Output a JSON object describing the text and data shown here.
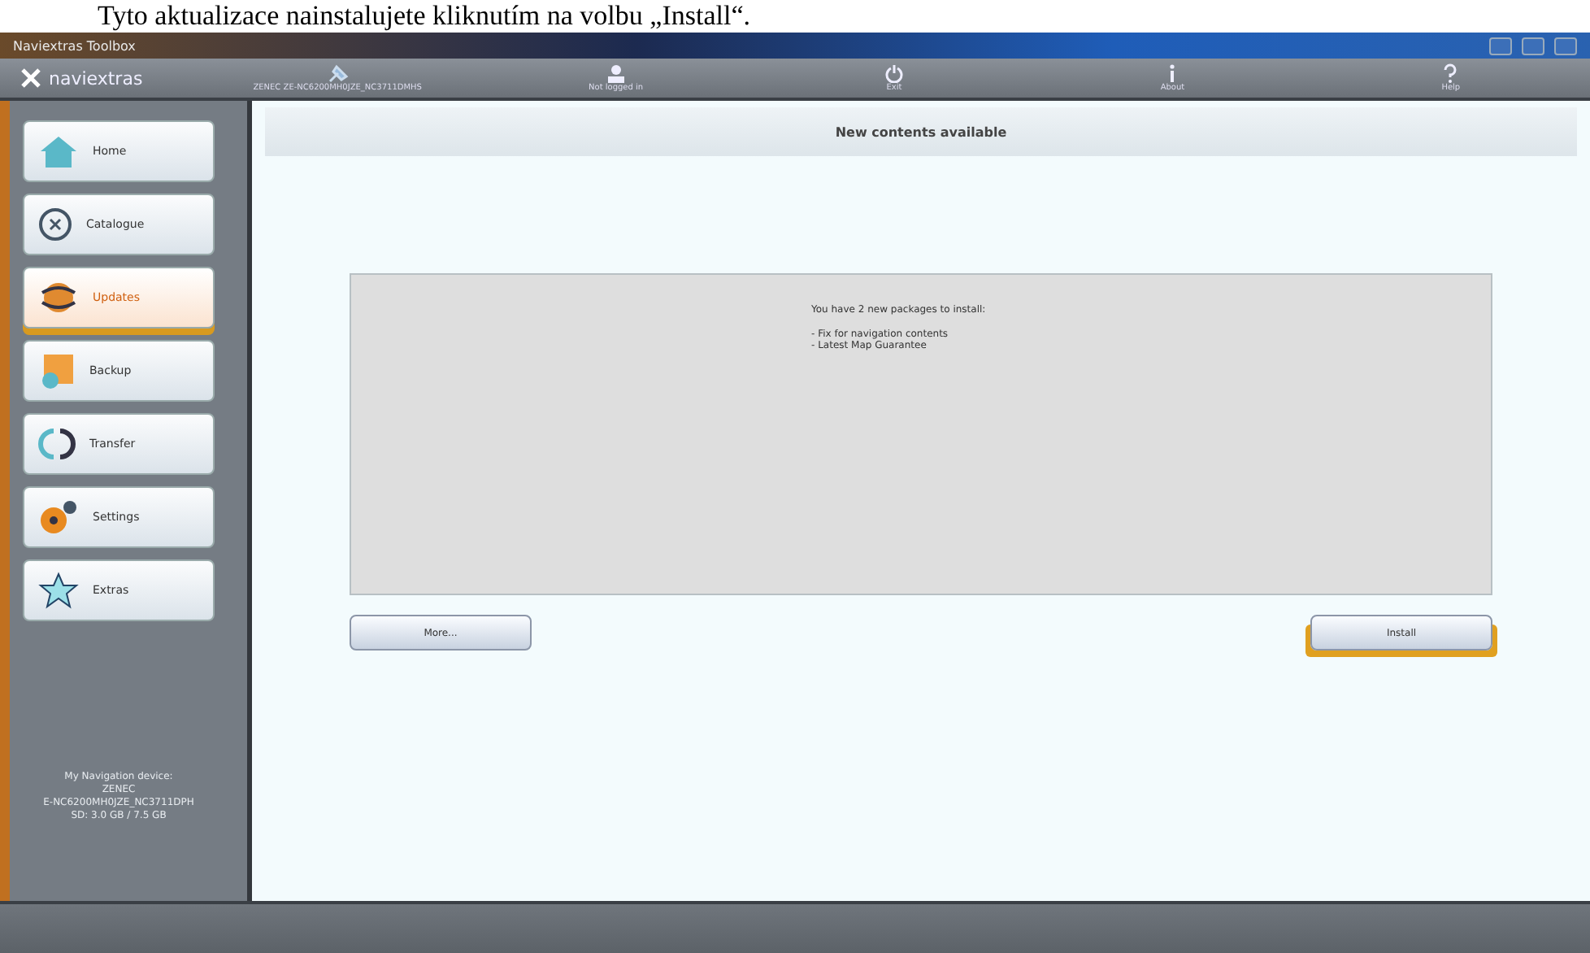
{
  "caption": "Tyto aktualizace nainstalujete kliknutím na volbu „Install“.",
  "window": {
    "title": "Naviextras Toolbox"
  },
  "toolbar": {
    "logo": "naviextras",
    "items": [
      {
        "kind": "device",
        "label": "ZENEC ZE-NC6200MH0JZE_NC3711DMHS"
      },
      {
        "kind": "user",
        "label": "Not logged in"
      },
      {
        "kind": "exit",
        "label": "Exit"
      },
      {
        "kind": "about",
        "label": "About"
      },
      {
        "kind": "help",
        "label": "Help"
      }
    ]
  },
  "sidebar": {
    "items": [
      {
        "kind": "home",
        "label": "Home",
        "selected": false
      },
      {
        "kind": "catalogue",
        "label": "Catalogue",
        "selected": false
      },
      {
        "kind": "updates",
        "label": "Updates",
        "selected": true
      },
      {
        "kind": "backup",
        "label": "Backup",
        "selected": false
      },
      {
        "kind": "transfer",
        "label": "Transfer",
        "selected": false
      },
      {
        "kind": "settings",
        "label": "Settings",
        "selected": false
      },
      {
        "kind": "extras",
        "label": "Extras",
        "selected": false
      }
    ],
    "device_info": [
      "My Navigation device:",
      "ZENEC",
      "E-NC6200MH0JZE_NC3711DPH",
      "SD: 3.0 GB / 7.5 GB"
    ]
  },
  "content": {
    "header": "New contents available",
    "message": "You have 2 new packages to install:",
    "packages": [
      "- Fix for navigation contents",
      "- Latest Map Guarantee"
    ],
    "buttons": [
      {
        "label": "More...",
        "highlighted": false
      },
      {
        "label": "Install",
        "highlighted": true
      }
    ]
  }
}
